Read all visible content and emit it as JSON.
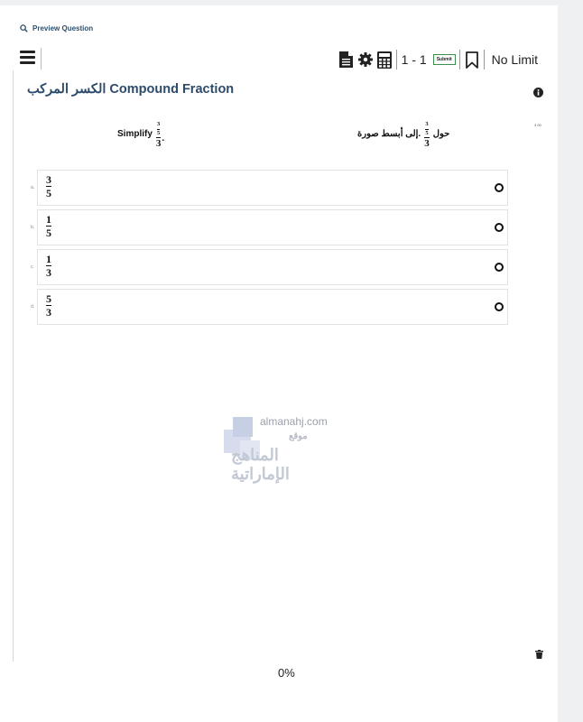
{
  "header": {
    "preview_label": "Preview Question",
    "counter": "1 - 1",
    "submit_label": "Submit",
    "limit_label": "No Limit"
  },
  "question": {
    "title": "الكسر المركب Compound Fraction",
    "side_number": "3 00",
    "stem_en": {
      "prefix": "Simplify",
      "suffix": ".",
      "outer_den": "3",
      "inner_num": "3",
      "inner_den": "5"
    },
    "stem_ar": {
      "prefix": "حول",
      "suffix": "إلى أبسط صورة.",
      "outer_den": "3",
      "inner_num": "3",
      "inner_den": "5"
    }
  },
  "options": [
    {
      "letter": "a.",
      "num": "3",
      "den": "5"
    },
    {
      "letter": "b.",
      "num": "1",
      "den": "5"
    },
    {
      "letter": "c.",
      "num": "1",
      "den": "3"
    },
    {
      "letter": "d.",
      "num": "5",
      "den": "3"
    }
  ],
  "watermark": {
    "site": "almanahj.com",
    "line1": "موقع",
    "line2": "المناهج الإماراتية"
  },
  "footer": {
    "progress": "0%"
  },
  "icons": {
    "preview": "search-icon",
    "menu": "hamburger-menu-icon",
    "document": "document-icon",
    "settings": "gear-icon",
    "calculator": "calculator-icon",
    "bookmark": "bookmark-icon",
    "info": "info-icon",
    "delete": "trash-icon"
  },
  "colors": {
    "title": "#2c4a6a",
    "submit_border": "#3b8f4b"
  }
}
